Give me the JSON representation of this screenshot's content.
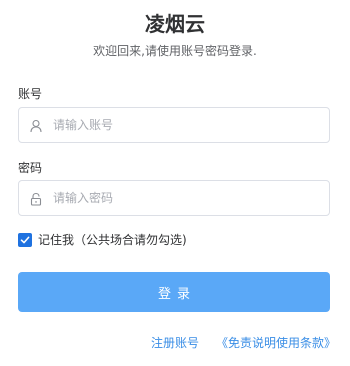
{
  "app": {
    "title": "凌烟云",
    "subtitle": "欢迎回来,请使用账号密码登录."
  },
  "form": {
    "account": {
      "label": "账号",
      "placeholder": "请输入账号",
      "value": "",
      "icon": "user-icon"
    },
    "password": {
      "label": "密码",
      "placeholder": "请输入密码",
      "value": "",
      "icon": "lock-icon"
    },
    "remember": {
      "checked": true,
      "label": "记住我（公共场合请勿勾选)"
    },
    "submit_label": "登录"
  },
  "links": {
    "register": "注册账号",
    "disclaimer": "《免责说明使用条款》"
  },
  "colors": {
    "primary_button": "#5aa8f7",
    "link": "#3a8ee6",
    "checkbox": "#1f72e0",
    "border": "#dcdfe6"
  }
}
